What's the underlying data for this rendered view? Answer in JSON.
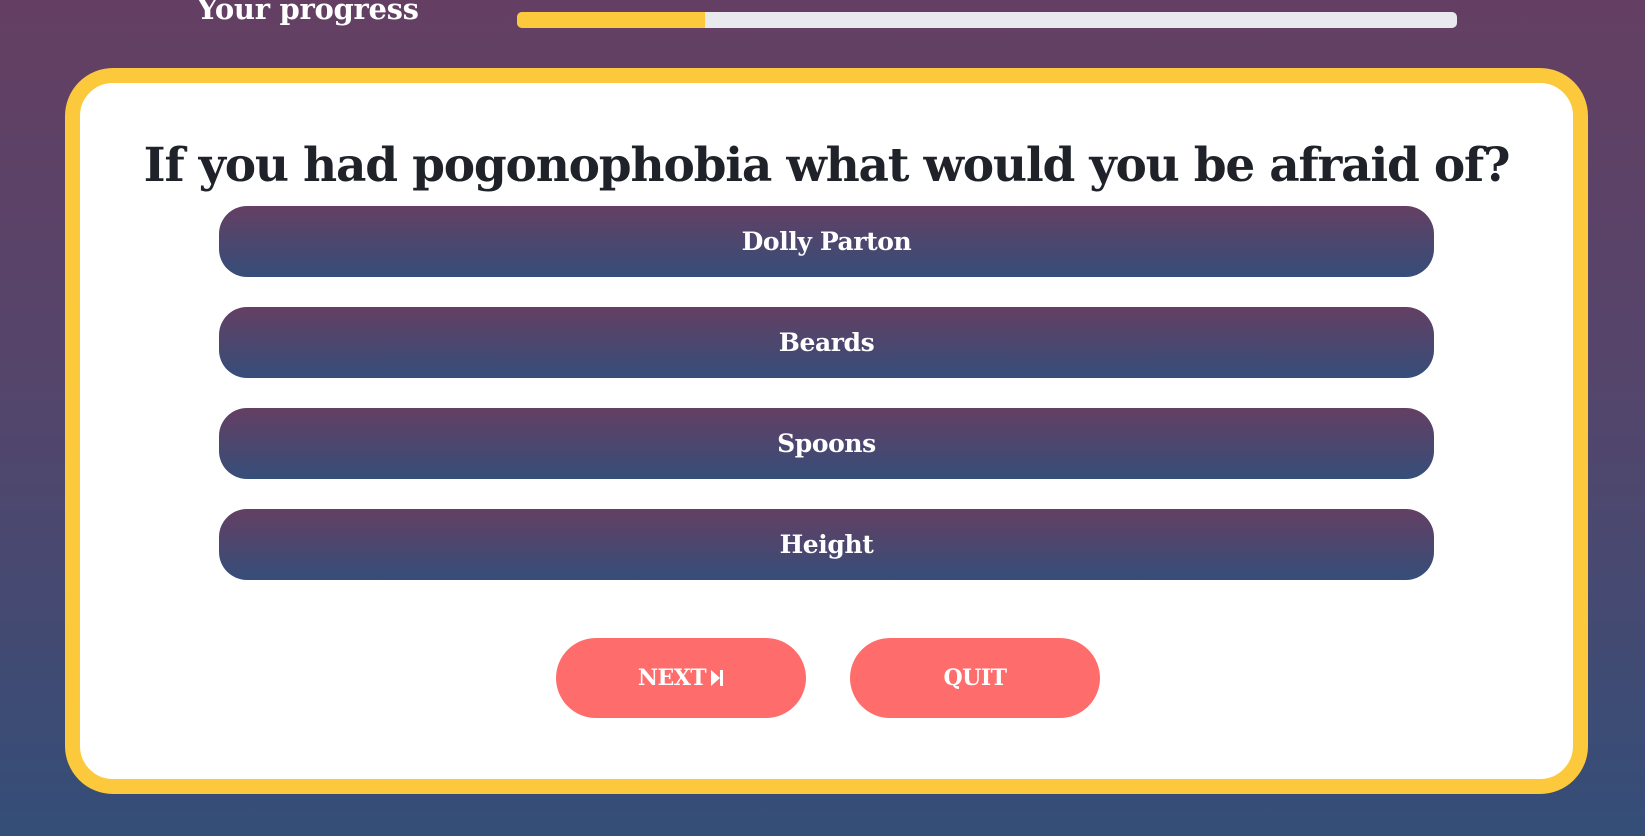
{
  "progress": {
    "label": "Your progress",
    "value": 0.2
  },
  "question": {
    "text": "If you had pogonophobia what would you be afraid of?"
  },
  "answers": [
    {
      "label": "Dolly Parton"
    },
    {
      "label": "Beards"
    },
    {
      "label": "Spoons"
    },
    {
      "label": "Height"
    }
  ],
  "controls": {
    "next_label": "NEXT",
    "next_icon": "skip-next-icon",
    "quit_label": "QUIT"
  },
  "colors": {
    "accent": "#fcc83c",
    "button": "#ff6c6c",
    "gradient_top": "#643f63",
    "gradient_bottom": "#344e78"
  }
}
